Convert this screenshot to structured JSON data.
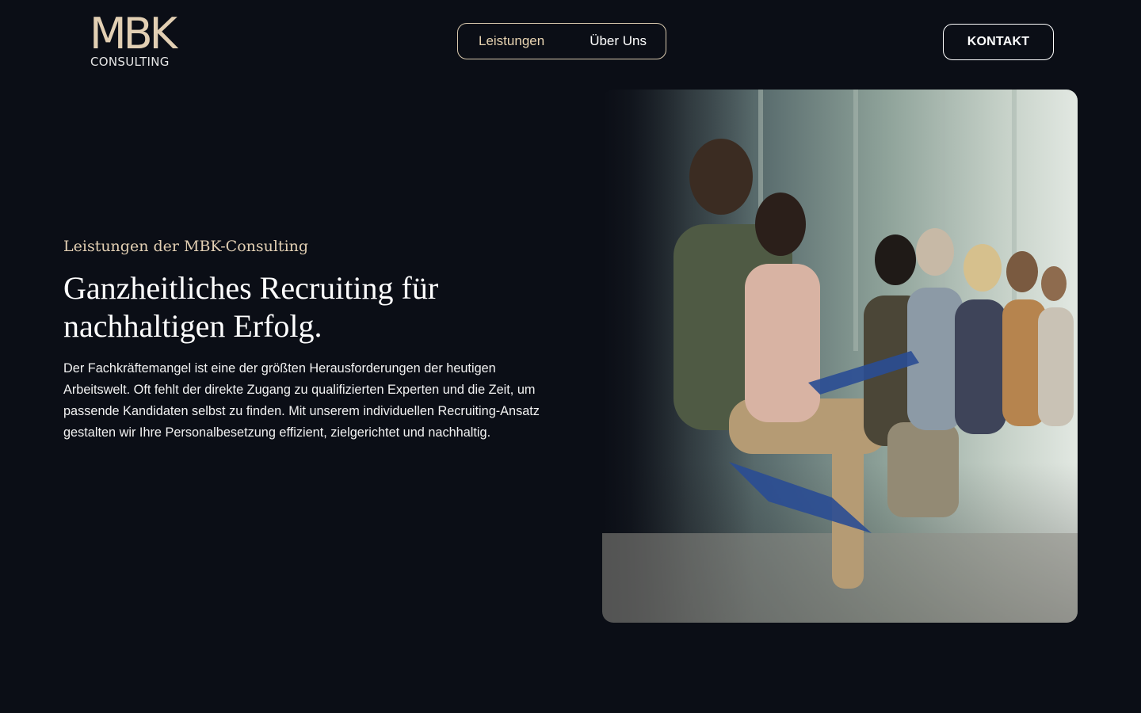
{
  "brand": {
    "mark": "MBK",
    "sub": "CONSULTING"
  },
  "nav": {
    "items": [
      {
        "label": "Leistungen",
        "active": true
      },
      {
        "label": "Über Uns",
        "active": false
      }
    ]
  },
  "cta": {
    "label": "KONTAKT"
  },
  "hero": {
    "eyebrow": "Leistungen der MBK-Consulting",
    "headline_line1": "Ganzheitliches Recruiting für",
    "headline_line2": "nachhaltigen Erfolg.",
    "body": "Der Fachkräftemangel ist eine der größten Herausforderungen der heutigen Arbeitswelt. Oft fehlt der direkte Zugang zu qualifizierten Experten und die Zeit, um passende Kandidaten selbst zu finden. Mit unserem individuellen Recruiting-Ansatz gestalten wir Ihre Personalbesetzung effizient, zielgerichtet und nachhaltig."
  },
  "colors": {
    "background": "#0b0e16",
    "accent": "#e2cfb3",
    "text": "#ffffff"
  }
}
